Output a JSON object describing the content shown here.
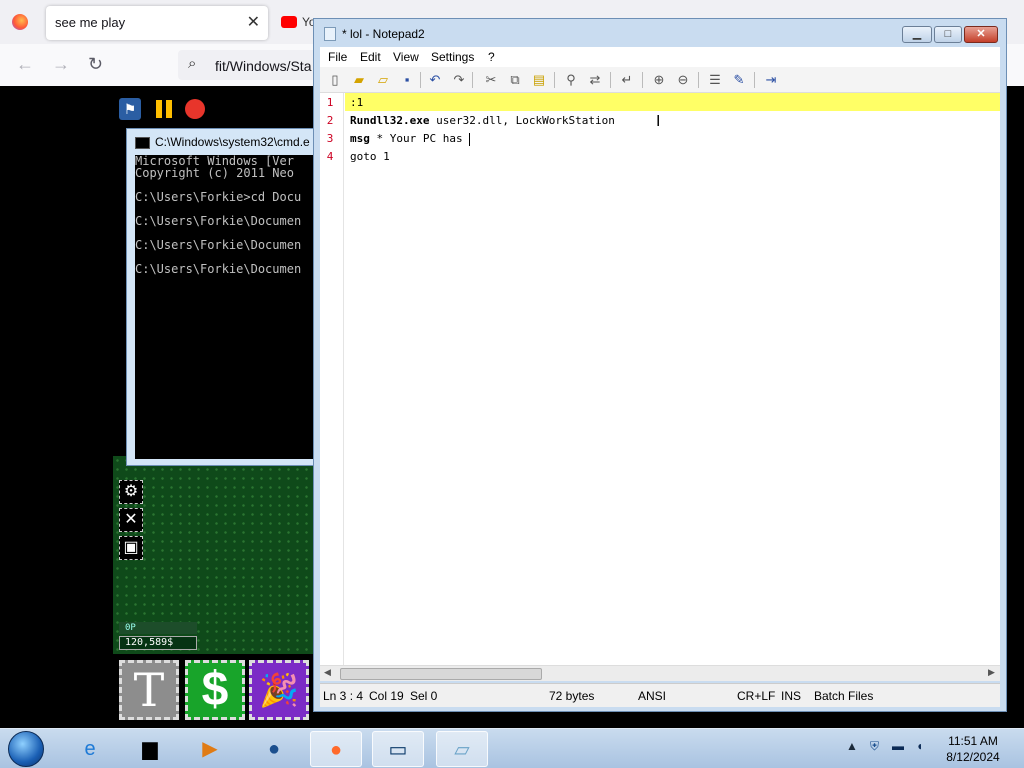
{
  "browser": {
    "active_tab_title": "see me play",
    "tab2_title": "Yo",
    "url": "fit/Windows/Sta"
  },
  "game": {
    "hud_xp": "0P",
    "hud_money": "120,589$",
    "power_t": "T",
    "power_dollar": "$",
    "power_party": "🎉"
  },
  "cmd": {
    "title": "C:\\Windows\\system32\\cmd.e",
    "lines": "Microsoft Windows [Ver\nCopyright (c) 2011 Neo\n\nC:\\Users\\Forkie>cd Docu\n\nC:\\Users\\Forkie\\Documen\n\nC:\\Users\\Forkie\\Documen\n\nC:\\Users\\Forkie\\Documen"
  },
  "notepad": {
    "title": "* lol - Notepad2",
    "menu": [
      "File",
      "Edit",
      "View",
      "Settings",
      "?"
    ],
    "lines": [
      {
        "num": "1",
        "text": ":1"
      },
      {
        "num": "2",
        "kw": "Rundll32.exe",
        "text": " user32.dll, LockWorkStation"
      },
      {
        "num": "3",
        "kw": "msg",
        "text": " * Your PC has "
      },
      {
        "num": "4",
        "kw": "goto",
        "text": " 1"
      }
    ],
    "status": {
      "position": "Ln 3 : 4",
      "col": "Col 19",
      "sel": "Sel 0",
      "size": "72 bytes",
      "encoding": "ANSI",
      "eol": "CR+LF",
      "mode": "INS",
      "scheme": "Batch Files"
    }
  },
  "taskbar": {
    "time": "11:51 AM",
    "date": "8/12/2024"
  }
}
